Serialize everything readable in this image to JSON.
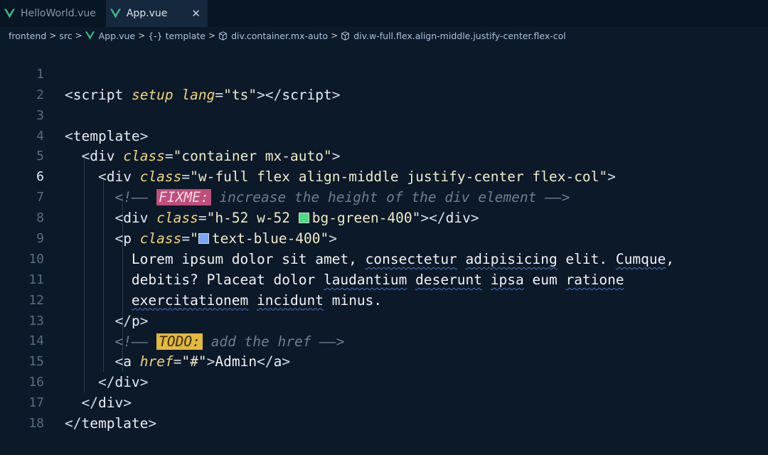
{
  "tabs": [
    {
      "label": "HelloWorld.vue",
      "active": false
    },
    {
      "label": "App.vue",
      "active": true,
      "close": "✕"
    }
  ],
  "breadcrumb": {
    "frontend": "frontend",
    "src": "src",
    "file": "App.vue",
    "template": "template",
    "div1": "div.container.mx-auto",
    "div2": "div.w-full.flex.align-middle.justify-center.flex-col"
  },
  "colors": {
    "vue": "#41b883",
    "green400": "#4ade80",
    "blue400": "#60a5fa",
    "fixme": "#c04d7a",
    "todo": "#e2b93a"
  },
  "line_numbers": [
    "1",
    "2",
    "3",
    "4",
    "5",
    "6",
    "7",
    "8",
    "9",
    "10",
    "11",
    "12",
    "13",
    "14",
    "15",
    "16",
    "17",
    "18"
  ],
  "current_line": "6",
  "code": {
    "l1": {
      "script_open": "script",
      "setup": "setup",
      "lang": "lang",
      "ts": "\"ts\"",
      "script_close": "script"
    },
    "l3": {
      "template": "template"
    },
    "l4": {
      "div": "div",
      "class": "class",
      "value": "\"container mx-auto\""
    },
    "l5": {
      "div": "div",
      "class": "class",
      "value": "\"w-full flex align-middle justify-center flex-col\""
    },
    "l6": {
      "open": "<!—— ",
      "keyword": "FIXME:",
      "text": " increase the height of the div element ",
      "close": "——>"
    },
    "l7": {
      "div": "div",
      "class": "class",
      "q1": "\"h-52 w-52 ",
      "val": "bg-green-400",
      "q2": "\"",
      "div_close": "div"
    },
    "l8": {
      "p": "p",
      "class": "class",
      "q1": "\"",
      "val": "text-blue-400",
      "q2": "\""
    },
    "l9": {
      "w1": "Lorem ipsum dolor sit amet, ",
      "w2": "consectetur",
      "w3": " ",
      "w4": "adipisicing",
      "w5": " elit. ",
      "w6": "Cumque",
      "w7": ","
    },
    "l10": {
      "w1": "debitis? Placeat dolor ",
      "w2": "laudantium",
      "w3": " ",
      "w4": "deserunt",
      "w5": " ",
      "w6": "ipsa",
      "w7": " eum ",
      "w8": "ratione"
    },
    "l11": {
      "w1": "exercitationem",
      "w2": " ",
      "w3": "incidunt",
      "w4": " minus."
    },
    "l12": {
      "p": "p"
    },
    "l13": {
      "open": "<!—— ",
      "keyword": "TODO:",
      "text": " add the href ",
      "close": "——>"
    },
    "l14": {
      "a": "a",
      "href": "href",
      "value": "\"#\"",
      "text": "Admin",
      "a_close": "a"
    },
    "l15": {
      "div": "div"
    },
    "l16": {
      "div": "div"
    },
    "l17": {
      "template": "template"
    }
  }
}
